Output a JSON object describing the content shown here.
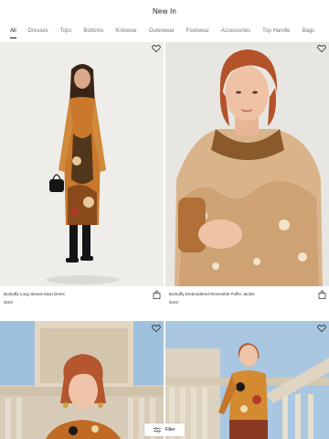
{
  "header": {
    "title": "New In"
  },
  "tabs": [
    {
      "label": "All",
      "active": true
    },
    {
      "label": "Dresses",
      "active": false
    },
    {
      "label": "Tops",
      "active": false
    },
    {
      "label": "Bottoms",
      "active": false
    },
    {
      "label": "Knitwear",
      "active": false
    },
    {
      "label": "Outerwear",
      "active": false
    },
    {
      "label": "Footwear",
      "active": false
    },
    {
      "label": "Accessories",
      "active": false
    },
    {
      "label": "Top Handle",
      "active": false
    },
    {
      "label": "Bags",
      "active": false
    }
  ],
  "products": [
    {
      "name": "Borboffy Long Sleeve Maxi Dress",
      "price": "$280"
    },
    {
      "name": "Borboffy Embroidered Reversible Puffer Jacket",
      "price": "$448"
    },
    {
      "name": "",
      "price": ""
    },
    {
      "name": "",
      "price": ""
    }
  ],
  "filter": {
    "label": "Filter"
  },
  "colors": {
    "background": "#ffffff",
    "text": "#1a1a1a",
    "muted": "#777777"
  }
}
